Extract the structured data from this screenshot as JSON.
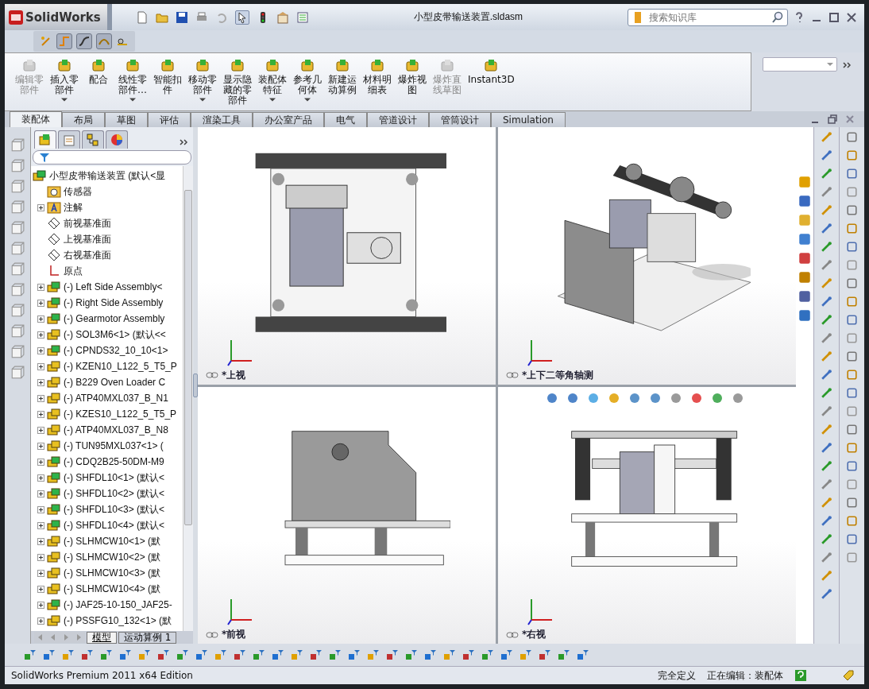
{
  "window": {
    "app_name": "SolidWorks",
    "title": "小型皮带输送装置.sldasm",
    "search": {
      "placeholder": "搜索知识库"
    }
  },
  "commands": [
    {
      "lines": [
        "编辑零",
        "部件"
      ],
      "disabled": true,
      "dropdown": false
    },
    {
      "lines": [
        "插入零",
        "部件"
      ],
      "disabled": false,
      "dropdown": true
    },
    {
      "lines": [
        "配合"
      ],
      "disabled": false,
      "dropdown": false
    },
    {
      "lines": [
        "线性零",
        "部件…"
      ],
      "disabled": false,
      "dropdown": true
    },
    {
      "lines": [
        "智能扣",
        "件"
      ],
      "disabled": false,
      "dropdown": false
    },
    {
      "lines": [
        "移动零",
        "部件"
      ],
      "disabled": false,
      "dropdown": true
    },
    {
      "lines": [
        "显示隐",
        "藏的零",
        "部件"
      ],
      "disabled": false,
      "dropdown": false
    },
    {
      "lines": [
        "装配体",
        "特征"
      ],
      "disabled": false,
      "dropdown": true
    },
    {
      "lines": [
        "参考几",
        "何体"
      ],
      "disabled": false,
      "dropdown": true
    },
    {
      "lines": [
        "新建运",
        "动算例"
      ],
      "disabled": false,
      "dropdown": false
    },
    {
      "lines": [
        "材料明",
        "细表"
      ],
      "disabled": false,
      "dropdown": false
    },
    {
      "lines": [
        "爆炸视",
        "图"
      ],
      "disabled": false,
      "dropdown": false
    },
    {
      "lines": [
        "爆炸直",
        "线草图"
      ],
      "disabled": true,
      "dropdown": false
    },
    {
      "lines": [
        "Instant3D"
      ],
      "disabled": false,
      "dropdown": false
    }
  ],
  "tabs": [
    {
      "label": "装配体",
      "selected": true
    },
    {
      "label": "布局",
      "selected": false
    },
    {
      "label": "草图",
      "selected": false
    },
    {
      "label": "评估",
      "selected": false
    },
    {
      "label": "渲染工具",
      "selected": false
    },
    {
      "label": "办公室产品",
      "selected": false
    },
    {
      "label": "电气",
      "selected": false
    },
    {
      "label": "管道设计",
      "selected": false
    },
    {
      "label": "管筒设计",
      "selected": false
    },
    {
      "label": "Simulation",
      "selected": false
    }
  ],
  "tree": {
    "root": "小型皮带输送装置  (默认<显",
    "items": [
      {
        "kind": "sensor",
        "label": "传感器",
        "expandable": false
      },
      {
        "kind": "annotation",
        "label": "注解",
        "expandable": true
      },
      {
        "kind": "plane",
        "label": "前视基准面",
        "expandable": false
      },
      {
        "kind": "plane",
        "label": "上视基准面",
        "expandable": false
      },
      {
        "kind": "plane",
        "label": "右视基准面",
        "expandable": false
      },
      {
        "kind": "origin",
        "label": "原点",
        "expandable": false
      },
      {
        "kind": "assembly",
        "label": "(-) Left Side Assembly<",
        "expandable": true
      },
      {
        "kind": "assembly",
        "label": "(-) Right Side Assembly",
        "expandable": true
      },
      {
        "kind": "assembly",
        "label": "(-) Gearmotor Assembly",
        "expandable": true
      },
      {
        "kind": "part",
        "label": "(-) SOL3M6<1> (默认<<",
        "expandable": true
      },
      {
        "kind": "assembly",
        "label": "(-) CPNDS32_10_10<1>",
        "expandable": true
      },
      {
        "kind": "part",
        "label": "(-) KZEN10_L122_5_T5_P",
        "expandable": true
      },
      {
        "kind": "part",
        "label": "(-) B229 Oven Loader C",
        "expandable": true
      },
      {
        "kind": "part",
        "label": "(-) ATP40MXL037_B_N1",
        "expandable": true
      },
      {
        "kind": "part",
        "label": "(-) KZES10_L122_5_T5_P",
        "expandable": true
      },
      {
        "kind": "part",
        "label": "(-) ATP40MXL037_B_N8",
        "expandable": true
      },
      {
        "kind": "part",
        "label": "(-) TUN95MXL037<1> (",
        "expandable": true
      },
      {
        "kind": "assembly",
        "label": "(-) CDQ2B25-50DM-M9",
        "expandable": true
      },
      {
        "kind": "assembly",
        "label": "(-) SHFDL10<1> (默认<",
        "expandable": true
      },
      {
        "kind": "assembly",
        "label": "(-) SHFDL10<2> (默认<",
        "expandable": true
      },
      {
        "kind": "assembly",
        "label": "(-) SHFDL10<3> (默认<",
        "expandable": true
      },
      {
        "kind": "assembly",
        "label": "(-) SHFDL10<4> (默认<",
        "expandable": true
      },
      {
        "kind": "part",
        "label": "(-) SLHMCW10<1> (默",
        "expandable": true
      },
      {
        "kind": "part",
        "label": "(-) SLHMCW10<2> (默",
        "expandable": true
      },
      {
        "kind": "part",
        "label": "(-) SLHMCW10<3> (默",
        "expandable": true
      },
      {
        "kind": "part",
        "label": "(-) SLHMCW10<4> (默",
        "expandable": true
      },
      {
        "kind": "assembly",
        "label": "(-) JAF25-10-150_JAF25-",
        "expandable": true
      },
      {
        "kind": "part",
        "label": "(-) PSSFG10_132<1> (默",
        "expandable": true
      }
    ]
  },
  "bottom_tabs": [
    {
      "label": "模型",
      "selected": true
    },
    {
      "label": "运动算例 1",
      "selected": false
    }
  ],
  "viewports": [
    {
      "kind": "top",
      "label": "*上视"
    },
    {
      "kind": "iso",
      "label": "*上下二等角轴测"
    },
    {
      "kind": "front",
      "label": "*前视"
    },
    {
      "kind": "right",
      "label": "*右视"
    }
  ],
  "status_bar": {
    "product": "SolidWorks Premium 2011 x64 Edition",
    "state": "完全定义",
    "editing": "正在编辑：装配体"
  }
}
